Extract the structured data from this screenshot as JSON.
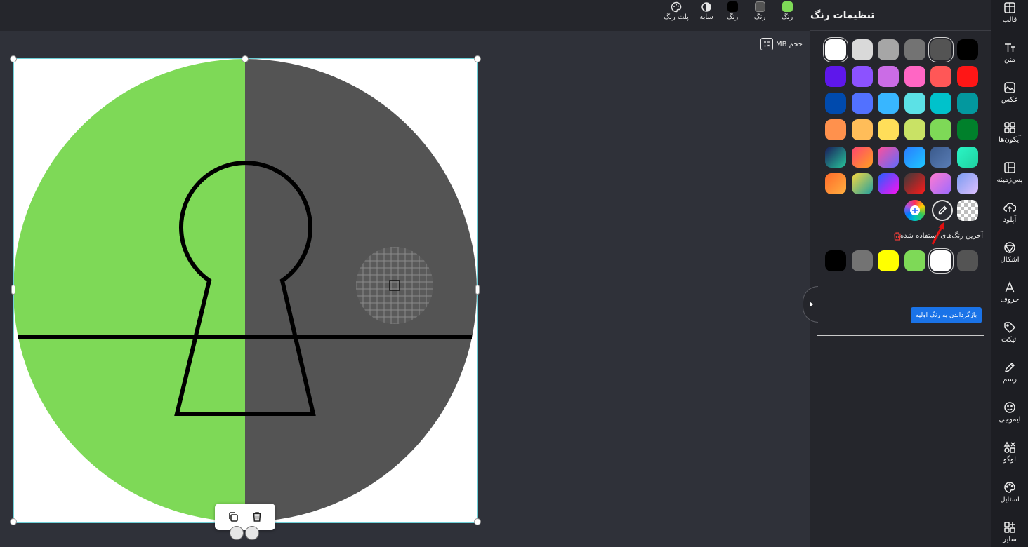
{
  "toolbar": {
    "items": [
      {
        "label": "رنگ",
        "color": "#7ed957"
      },
      {
        "label": "رنگ",
        "color": "#545454"
      },
      {
        "label": "رنگ",
        "color": "#000000"
      },
      {
        "label": "سایه",
        "icon": "shadow-icon"
      },
      {
        "label": "پلت رنگ",
        "icon": "palette-icon"
      }
    ]
  },
  "canvas": {
    "size_label": "حجم MB",
    "size_icon": "calculator-icon",
    "selection_color": "#6fd0d8",
    "circle_left_color": "#7ed957",
    "circle_right_color": "#545454"
  },
  "floating_toolbar": {
    "duplicate_icon": "duplicate-icon",
    "delete_icon": "trash-icon"
  },
  "panel": {
    "title": "تنظیمات رنگ",
    "recent_label": "آخرین رنگ‌های استفاده شده:",
    "reset_label": "بازگرداندن به رنگ اولیه",
    "reset_color": "#1a73e8",
    "swatch_rows": [
      [
        "#000000",
        "#545454",
        "#737373",
        "#a6a6a6",
        "#d9d9d9",
        "#ffffff"
      ],
      [
        "#ff1616",
        "#ff5757",
        "#ff66c4",
        "#cb6ce6",
        "#8c52ff",
        "#5e17eb"
      ],
      [
        "#03989e",
        "#00c2cb",
        "#5ce1e6",
        "#38b6ff",
        "#5271ff",
        "#004aad"
      ],
      [
        "#00802b",
        "#7ed957",
        "#c9e265",
        "#ffde59",
        "#ffbd59",
        "#ff914d"
      ]
    ],
    "gradient_rows": [
      [
        [
          "#2bf6c6",
          "#1fd1a0"
        ],
        [
          "#3a5a8c",
          "#5a7db5"
        ],
        [
          "#2a7bff",
          "#1ec8ff"
        ],
        [
          "#ff4f9a",
          "#5f6bff"
        ],
        [
          "#ff4470",
          "#ffa020"
        ],
        [
          "#1a1a5a",
          "#27c49a"
        ]
      ],
      [
        [
          "#7a9cf0",
          "#e0c0ff"
        ],
        [
          "#ff7ad1",
          "#9b6bff"
        ],
        [
          "#3a3a3a",
          "#ff1a1a"
        ],
        [
          "#2060ff",
          "#ff10f0"
        ],
        [
          "#f8d840",
          "#20a0a0"
        ],
        [
          "#ff6a2a",
          "#ffb040"
        ]
      ]
    ],
    "special_swatches": [
      "transparent",
      "eyedropper-icon",
      "color-picker-plus-icon"
    ],
    "recent_colors": [
      "#545454",
      "#ffffff",
      "#7ed957",
      "#ffff00",
      "#737373",
      "#000000"
    ],
    "selected_swatch": "#545454"
  },
  "sidenav": [
    {
      "label": "قالب",
      "icon": "template-icon"
    },
    {
      "label": "متن",
      "icon": "text-icon"
    },
    {
      "label": "عکس",
      "icon": "photo-icon"
    },
    {
      "label": "آیکون‌ها",
      "icon": "icons-grid-icon"
    },
    {
      "label": "پس‌زمینه",
      "icon": "background-icon"
    },
    {
      "label": "آپلود",
      "icon": "upload-icon"
    },
    {
      "label": "اشکال",
      "icon": "shapes-icon"
    },
    {
      "label": "حروف",
      "icon": "letters-icon"
    },
    {
      "label": "اتیکت",
      "icon": "tag-icon"
    },
    {
      "label": "رسم",
      "icon": "pencil-icon"
    },
    {
      "label": "ایموجی",
      "icon": "emoji-icon"
    },
    {
      "label": "لوگو",
      "icon": "logo-icon"
    },
    {
      "label": "استایل",
      "icon": "style-icon"
    },
    {
      "label": "سایر",
      "icon": "more-icon"
    }
  ]
}
